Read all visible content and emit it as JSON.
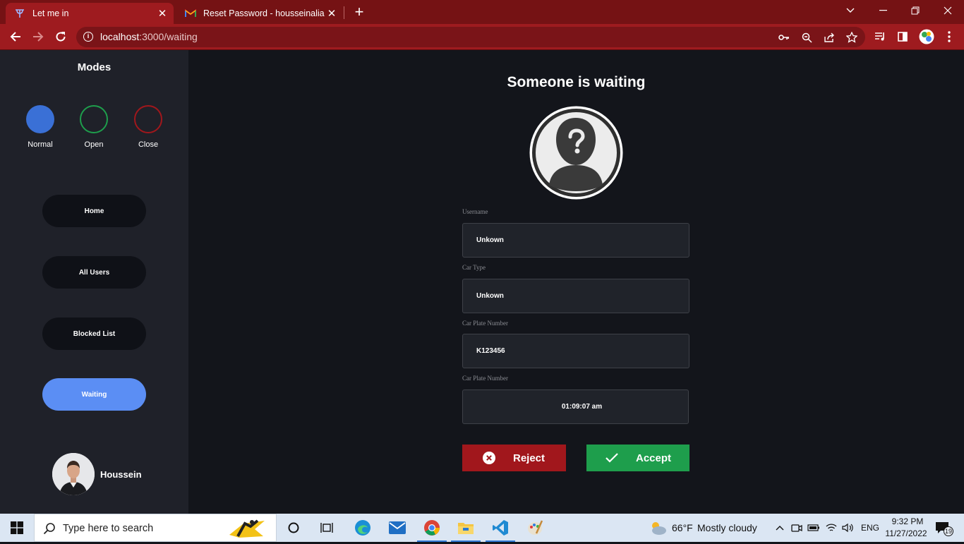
{
  "browser": {
    "tabs": [
      {
        "title": "Let me in",
        "active": true
      },
      {
        "title": "Reset Password - housseinalialdr",
        "active": false
      }
    ],
    "url_host": "localhost",
    "url_path": ":3000/waiting"
  },
  "sidebar": {
    "title": "Modes",
    "modes": [
      {
        "label": "Normal",
        "color": "#3a70d6"
      },
      {
        "label": "Open",
        "color": "#1e9e4c"
      },
      {
        "label": "Close",
        "color": "#a1171c"
      }
    ],
    "nav": [
      {
        "label": "Home",
        "active": false
      },
      {
        "label": "All Users",
        "active": false
      },
      {
        "label": "Blocked List",
        "active": false
      },
      {
        "label": "Waiting",
        "active": true
      }
    ],
    "profile_name": "Houssein"
  },
  "main": {
    "title": "Someone is waiting",
    "fields": [
      {
        "label": "Username",
        "value": "Unkown"
      },
      {
        "label": "Car Type",
        "value": "Unkown"
      },
      {
        "label": "Car Plate Number",
        "value": "K123456"
      },
      {
        "label": "Car Plate Number",
        "value": "01:09:07 am"
      }
    ],
    "reject_label": "Reject",
    "accept_label": "Accept"
  },
  "taskbar": {
    "search_placeholder": "Type here to search",
    "weather_temp": "66°F",
    "weather_text": "Mostly cloudy",
    "language": "ENG",
    "time": "9:32 PM",
    "date": "11/27/2022",
    "notification_count": "19"
  },
  "colors": {
    "browser_frame": "#751214",
    "browser_toolbar": "#9e1b1f",
    "sidebar_bg": "#1f2129",
    "main_bg": "#13151b",
    "active_nav": "#5b8ef4",
    "reject": "#a1171c",
    "accept": "#1e9e4c"
  }
}
